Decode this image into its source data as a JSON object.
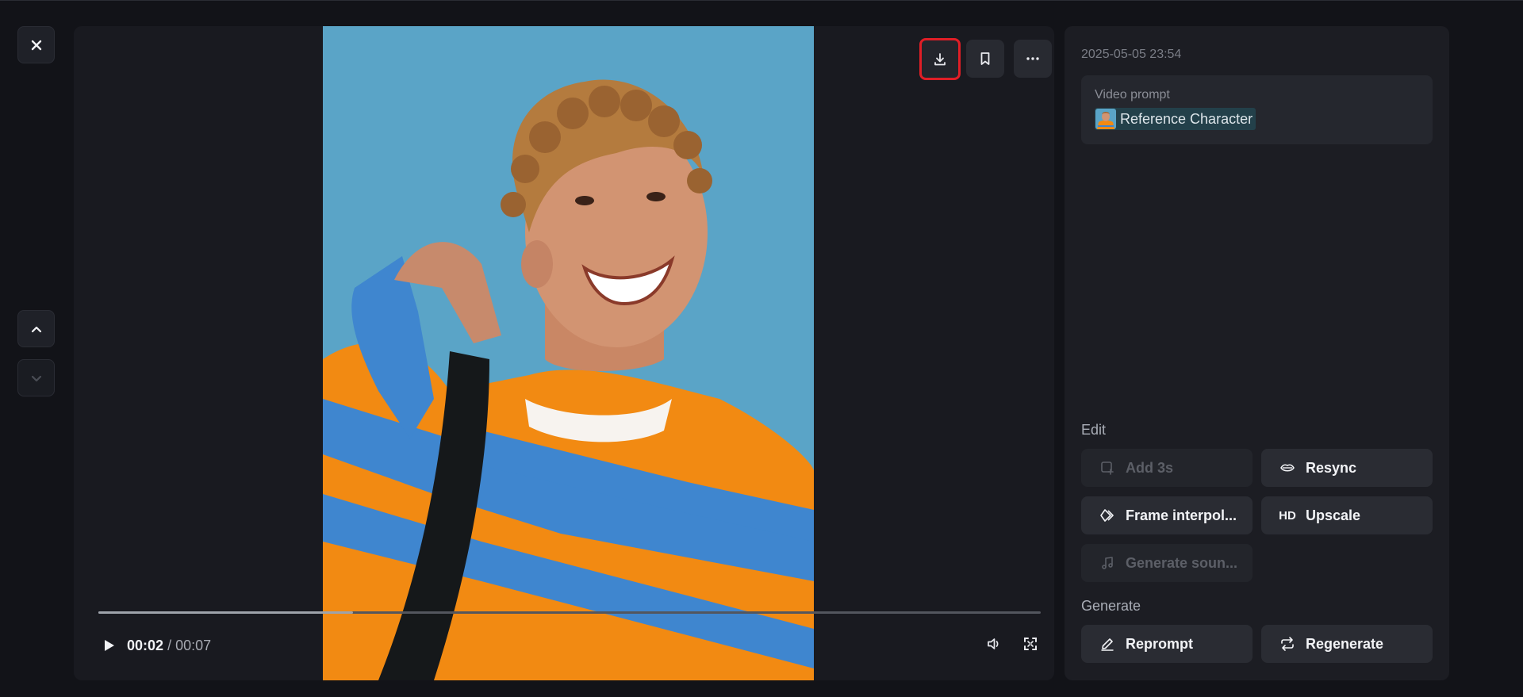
{
  "nav": {
    "close_icon": "close-icon",
    "up_icon": "chevron-up-icon",
    "down_icon": "chevron-down-icon"
  },
  "player": {
    "actions": [
      "download-icon",
      "bookmark-icon",
      "more-icon"
    ],
    "current_time": "00:02",
    "separator": "/",
    "total_time": "00:07",
    "progress": 0.27
  },
  "panel": {
    "timestamp": "2025-05-05 23:54",
    "prompt_label": "Video prompt",
    "reference_chip": "Reference Character",
    "edit_label": "Edit",
    "generate_label": "Generate",
    "buttons": {
      "add3s": "Add 3s",
      "resync": "Resync",
      "frame_interp": "Frame interpol...",
      "upscale": "Upscale",
      "upscale_badge": "HD",
      "gen_sound": "Generate soun...",
      "reprompt": "Reprompt",
      "regenerate": "Regenerate"
    }
  },
  "colors": {
    "accent_highlight": "#e01e26",
    "background": "#121318",
    "panel": "#1c1d23"
  }
}
